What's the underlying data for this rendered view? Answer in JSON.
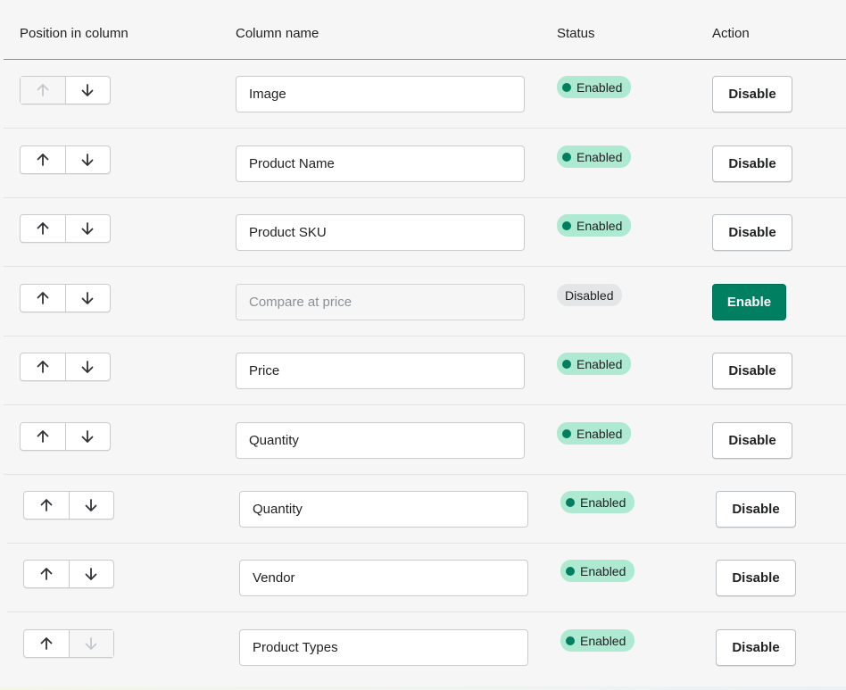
{
  "header": {
    "position": "Position in column",
    "column_name": "Column name",
    "status": "Status",
    "action": "Action"
  },
  "rows": [
    {
      "name": "Image",
      "status": "Enabled",
      "enabled": true,
      "action": "Disable",
      "up_disabled": true,
      "down_disabled": false
    },
    {
      "name": "Product Name",
      "status": "Enabled",
      "enabled": true,
      "action": "Disable",
      "up_disabled": false,
      "down_disabled": false
    },
    {
      "name": "Product SKU",
      "status": "Enabled",
      "enabled": true,
      "action": "Disable",
      "up_disabled": false,
      "down_disabled": false
    },
    {
      "name": "Compare at price",
      "status": "Disabled",
      "enabled": false,
      "action": "Enable",
      "up_disabled": false,
      "down_disabled": false
    },
    {
      "name": "Price",
      "status": "Enabled",
      "enabled": true,
      "action": "Disable",
      "up_disabled": false,
      "down_disabled": false
    },
    {
      "name": "Quantity",
      "status": "Enabled",
      "enabled": true,
      "action": "Disable",
      "up_disabled": false,
      "down_disabled": false
    },
    {
      "name": "Quantity",
      "status": "Enabled",
      "enabled": true,
      "action": "Disable",
      "up_disabled": false,
      "down_disabled": false
    },
    {
      "name": "Vendor",
      "status": "Enabled",
      "enabled": true,
      "action": "Disable",
      "up_disabled": false,
      "down_disabled": false
    },
    {
      "name": "Product Types",
      "status": "Enabled",
      "enabled": true,
      "action": "Disable",
      "up_disabled": false,
      "down_disabled": true
    }
  ],
  "icons": {
    "up": "arrow-up-icon",
    "down": "arrow-down-icon",
    "status_dot": "status-dot-icon"
  },
  "colors": {
    "enabled_badge": "#aee9d1",
    "enabled_dot": "#007f5f",
    "disabled_badge": "#e4e5e7",
    "primary_button": "#008060"
  }
}
